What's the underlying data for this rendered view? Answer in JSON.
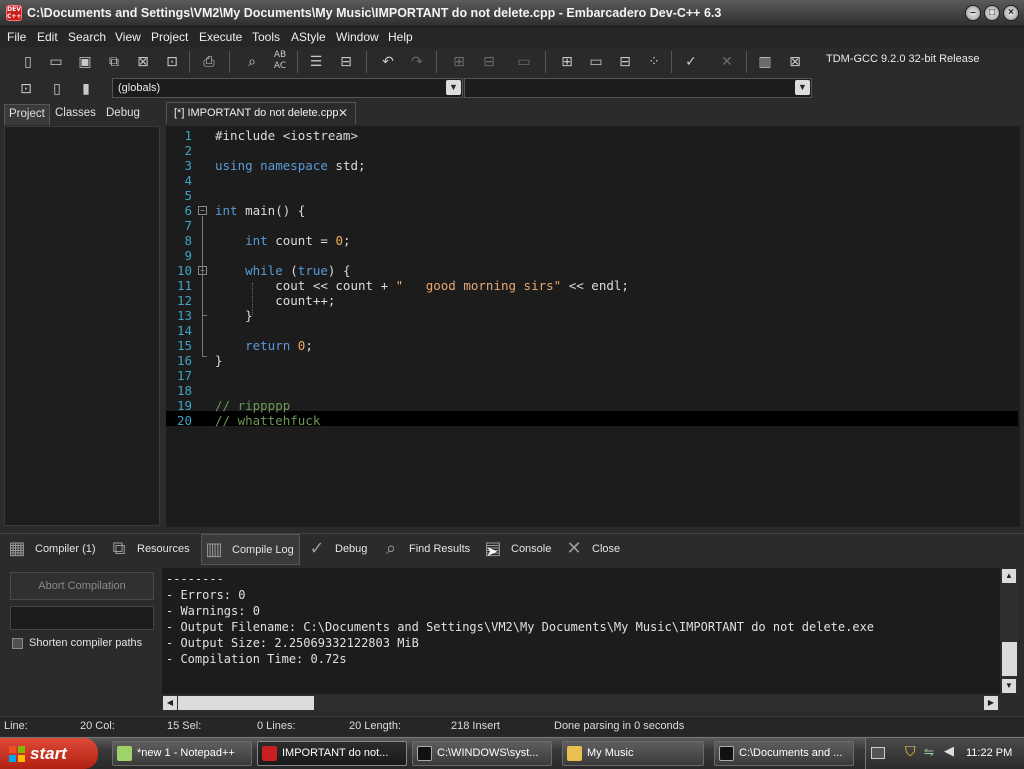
{
  "window": {
    "title": "C:\\Documents and Settings\\VM2\\My Documents\\My Music\\IMPORTANT do not delete.cpp - Embarcadero Dev-C++ 6.3",
    "app_icon_text": "DEV C++"
  },
  "menu": [
    "File",
    "Edit",
    "Search",
    "View",
    "Project",
    "Execute",
    "Tools",
    "AStyle",
    "Window",
    "Help"
  ],
  "toolbar": {
    "compiler_select": "TDM-GCC 9.2.0 32-bit Release",
    "scope_select": "(globals)",
    "icons": [
      "new-file-icon",
      "open-file-icon",
      "save-icon",
      "save-all-icon",
      "close-file-icon",
      "close-all-icon",
      "print-icon",
      "find-icon",
      "replace-icon",
      "indent-icon",
      "unindent-icon",
      "undo-icon",
      "redo-icon",
      "compile-icon",
      "run-icon",
      "compile-run-icon",
      "rebuild-icon",
      "layout-icon",
      "debug-icon",
      "check-icon",
      "stop-icon",
      "profile-icon",
      "delete-profile-icon"
    ]
  },
  "left_tabs": [
    "Project",
    "Classes",
    "Debug"
  ],
  "file_tab": "[*] IMPORTANT do not delete.cpp",
  "code": {
    "line_numbers": [
      "1",
      "2",
      "3",
      "4",
      "5",
      "6",
      "7",
      "8",
      "9",
      "10",
      "11",
      "12",
      "13",
      "14",
      "15",
      "16",
      "17",
      "18",
      "19",
      "20"
    ],
    "lines": [
      [
        {
          "t": "#include <iostream>",
          "c": "plain"
        }
      ],
      [],
      [
        {
          "t": "using namespace ",
          "c": "kw"
        },
        {
          "t": "std;",
          "c": "plain"
        }
      ],
      [],
      [],
      [
        {
          "t": "int ",
          "c": "kw"
        },
        {
          "t": "main() {",
          "c": "plain"
        }
      ],
      [],
      [
        {
          "t": "    int ",
          "c": "kw"
        },
        {
          "t": "count = ",
          "c": "plain"
        },
        {
          "t": "0",
          "c": "num"
        },
        {
          "t": ";",
          "c": "plain"
        }
      ],
      [],
      [
        {
          "t": "    while ",
          "c": "kw"
        },
        {
          "t": "(",
          "c": "plain"
        },
        {
          "t": "true",
          "c": "kw"
        },
        {
          "t": ") {",
          "c": "plain"
        }
      ],
      [
        {
          "t": "        cout << count + ",
          "c": "plain"
        },
        {
          "t": "\"   good morning sirs\"",
          "c": "str"
        },
        {
          "t": " << endl;",
          "c": "plain"
        }
      ],
      [
        {
          "t": "        count++;",
          "c": "plain"
        }
      ],
      [
        {
          "t": "    }",
          "c": "plain"
        }
      ],
      [],
      [
        {
          "t": "    return ",
          "c": "kw"
        },
        {
          "t": "0",
          "c": "num"
        },
        {
          "t": ";",
          "c": "plain"
        }
      ],
      [
        {
          "t": "}",
          "c": "plain"
        }
      ],
      [],
      [],
      [
        {
          "t": "// rippppp",
          "c": "cmt"
        }
      ],
      [
        {
          "t": "// whattehfuck",
          "c": "cmt"
        }
      ]
    ]
  },
  "bottom_tabs": [
    "Compiler (1)",
    "Resources",
    "Compile Log",
    "Debug",
    "Find Results",
    "Console",
    "Close"
  ],
  "compile_panel": {
    "abort_label": "Abort Compilation",
    "shorten_label": "Shorten compiler paths",
    "log_text": "--------\n- Errors: 0\n- Warnings: 0\n- Output Filename: C:\\Documents and Settings\\VM2\\My Documents\\My Music\\IMPORTANT do not delete.exe\n- Output Size: 2.25069332122803 MiB\n- Compilation Time: 0.72s"
  },
  "status": {
    "line": "Line:",
    "col": "20 Col:",
    "sel": "15 Sel:",
    "lines": "0 Lines:",
    "length": "20 Length:",
    "insert": "218 Insert",
    "parse": "Done parsing in 0 seconds"
  },
  "taskbar": {
    "start": "start",
    "tasks": [
      "*new 1 - Notepad++",
      "IMPORTANT do not...",
      "C:\\WINDOWS\\syst...",
      "My Music",
      "C:\\Documents and ..."
    ],
    "clock": "11:22 PM"
  }
}
